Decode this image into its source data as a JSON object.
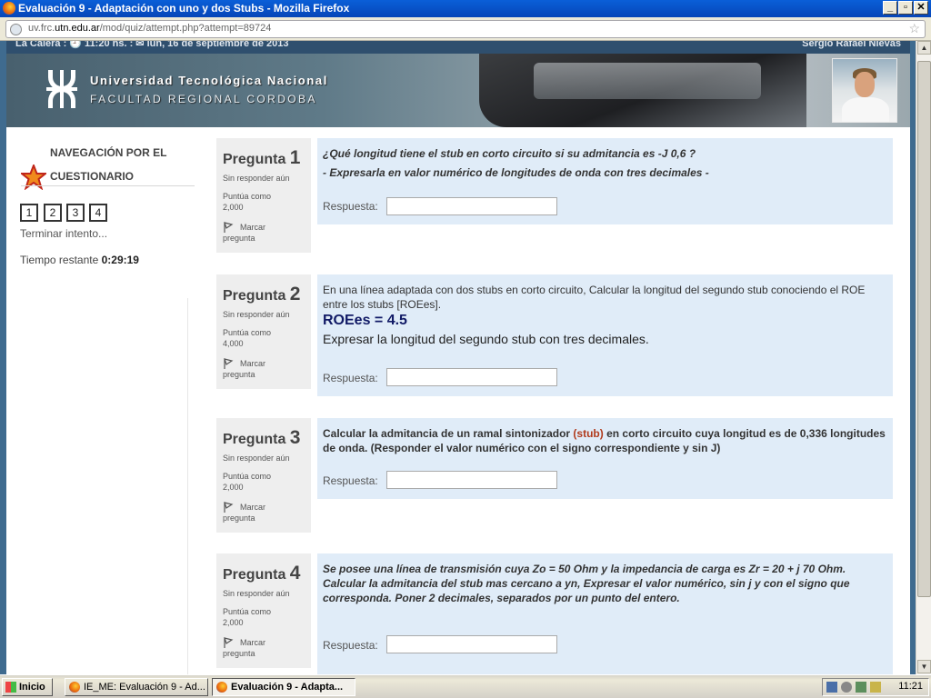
{
  "window": {
    "title": "Evaluación 9 - Adaptación con uno y dos Stubs - Mozilla Firefox",
    "controls": {
      "minimize": "_",
      "maximize": "▫",
      "close": "✕"
    }
  },
  "address_bar": {
    "url_prefix": "uv.frc.",
    "url_domain": "utn.edu.ar",
    "url_path": "/mod/quiz/attempt.php?attempt=89724",
    "bookmark_icon": "star-icon"
  },
  "header": {
    "strip_left": "La Calera : 🕘 11:20 hs. : ✉ lun, 16 de septiembre de 2013",
    "strip_right": "Sergio Rafael Nievas",
    "university": "Universidad Tecnológica Nacional",
    "faculty": "FACULTAD REGIONAL CORDOBA"
  },
  "navigation": {
    "title": "NAVEGACIÓN POR EL CUESTIONARIO",
    "question_buttons": [
      "1",
      "2",
      "3",
      "4"
    ],
    "finish_attempt": "Terminar intento...",
    "time_label": "Tiempo restante",
    "time_value": "0:29:19"
  },
  "questions": [
    {
      "label": "Pregunta",
      "number": "1",
      "status": "Sin responder aún",
      "score_label": "Puntúa como",
      "score": "2,000",
      "flag_line1": "Marcar",
      "flag_line2": "pregunta",
      "text1": "¿Qué longitud tiene el stub en corto circuito si su admitancia es -J 0,6 ?",
      "text2": "- Expresarla en valor numérico de longitudes de onda con tres decimales -",
      "response_label": "Respuesta:"
    },
    {
      "label": "Pregunta",
      "number": "2",
      "status": "Sin responder aún",
      "score_label": "Puntúa como",
      "score": "4,000",
      "flag_line1": "Marcar",
      "flag_line2": "pregunta",
      "text1": "En una línea adaptada con dos stubs en corto circuito, Calcular la longitud del segundo stub conociendo el ROE entre los stubs [ROEes].",
      "text2": "ROEes = 4.5",
      "text3": "Expresar la longitud del segundo stub con tres decimales.",
      "response_label": "Respuesta:"
    },
    {
      "label": "Pregunta",
      "number": "3",
      "status": "Sin responder aún",
      "score_label": "Puntúa como",
      "score": "2,000",
      "flag_line1": "Marcar",
      "flag_line2": "pregunta",
      "text1": "Calcular la admitancia de un ramal sintonizador",
      "text_stub": "(stub)",
      "text2": "en corto circuito cuya longitud es de 0,336 longitudes de onda. (Responder el valor numérico con el signo correspondiente y sin J)",
      "response_label": "Respuesta:"
    },
    {
      "label": "Pregunta",
      "number": "4",
      "status": "Sin responder aún",
      "score_label": "Puntúa como",
      "score": "2,000",
      "flag_line1": "Marcar",
      "flag_line2": "pregunta",
      "text1": "Se posee una línea de transmisión cuya Zo = 50 Ohm y la impedancia de carga es Zr = 20 + j 70 Ohm.",
      "text2": "Calcular la admitancia del stub mas cercano a yn, Expresar el valor numérico, sin j y con el signo que corresponda. Poner 2 decimales, separados por un punto del entero.",
      "response_label": "Respuesta:"
    }
  ],
  "taskbar": {
    "start": "Inicio",
    "tasks": [
      "IE_ME: Evaluación 9 - Ad...",
      "Evaluación 9 - Adapta..."
    ],
    "clock": "11:21"
  },
  "colors": {
    "title_bar": "#0646b8",
    "question_box": "#e0ecf8",
    "info_box": "#eeeeee",
    "roe_text": "#111a66",
    "stub_text": "#b03a1c"
  }
}
